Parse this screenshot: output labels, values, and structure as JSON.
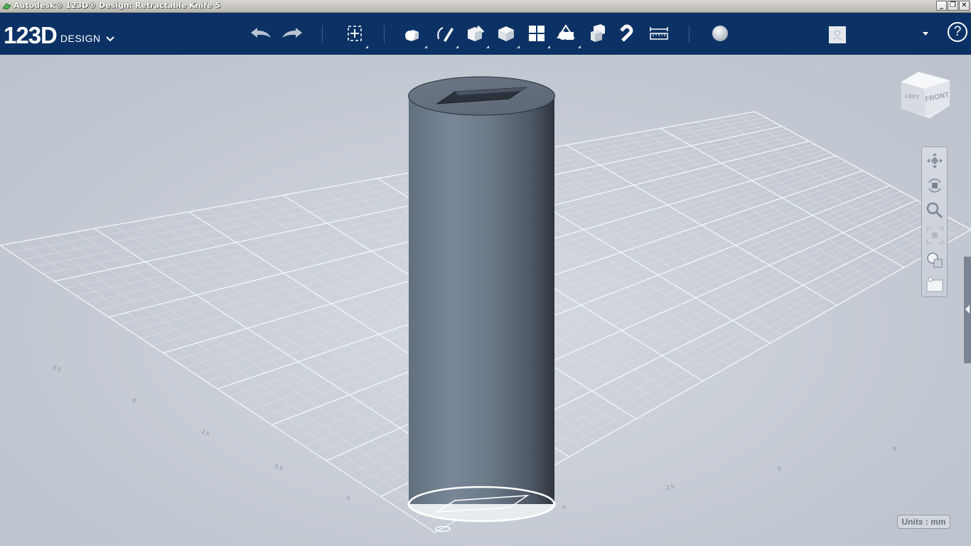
{
  "window": {
    "title": "Autodesk® 123D® Design: Retractable Knife 5",
    "controls": {
      "minimize": "_",
      "restore": "❐",
      "close": "✕"
    }
  },
  "logo": {
    "number": "123D",
    "word": "DESIGN"
  },
  "toolbar": {
    "tools": [
      {
        "name": "undo",
        "icon": "undo-arrow-icon"
      },
      {
        "name": "redo",
        "icon": "redo-arrow-icon"
      },
      {
        "name": "transform",
        "icon": "move-transform-icon"
      },
      {
        "name": "primitives",
        "icon": "primitive-shapes-icon"
      },
      {
        "name": "sketch",
        "icon": "sketch-pencil-icon"
      },
      {
        "name": "construct",
        "icon": "construct-extrude-icon"
      },
      {
        "name": "modify",
        "icon": "modify-box-icon"
      },
      {
        "name": "pattern",
        "icon": "pattern-grid-icon"
      },
      {
        "name": "grouping",
        "icon": "group-shapes-icon"
      },
      {
        "name": "combine",
        "icon": "combine-boolean-icon"
      },
      {
        "name": "snap",
        "icon": "magnet-snap-icon"
      },
      {
        "name": "measure",
        "icon": "ruler-measure-icon"
      },
      {
        "name": "material",
        "icon": "material-sphere-icon"
      }
    ],
    "help": "?"
  },
  "viewcube": {
    "left": "LEFT",
    "front": "FRONT"
  },
  "navbar": {
    "items": [
      "pan-icon",
      "orbit-icon",
      "zoom-icon",
      "fit-icon",
      "visual-style-icon",
      "material-browser-icon"
    ]
  },
  "grid": {
    "labels": [
      "-2.5",
      "0",
      "2.5",
      "-2.5",
      "-5",
      "-5",
      "2.5",
      "5",
      "0",
      "-0.5"
    ]
  },
  "units": {
    "label": "Units : mm"
  },
  "colors": {
    "toolbar": "#0c3265",
    "viewport": "#c6ccd4",
    "cylinder": "#6b7888"
  }
}
